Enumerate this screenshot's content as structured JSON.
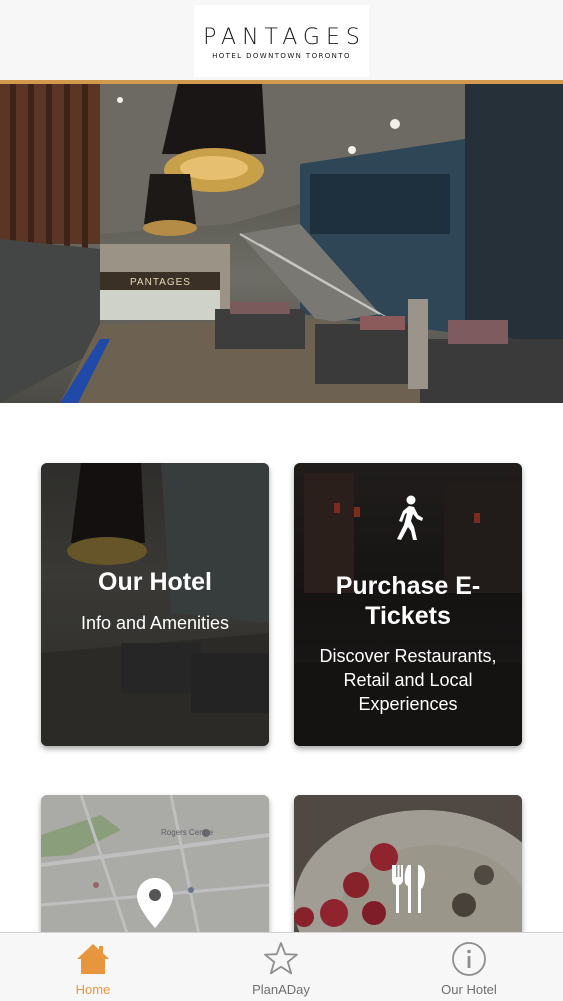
{
  "header": {
    "logo_main": "PANTAGES",
    "logo_sub": "HOTEL DOWNTOWN TORONTO",
    "accent_color": "#d3994f"
  },
  "hero": {
    "sign_text": "PANTAGES"
  },
  "tiles": [
    {
      "title": "Our Hotel",
      "subtitle": "Info and Amenities",
      "icon": "none"
    },
    {
      "title_line1": "Purchase E-",
      "title_line2": "Tickets",
      "subtitle_line1": "Discover Restaurants,",
      "subtitle_line2": "Retail and Local",
      "subtitle_line3": "Experiences",
      "icon": "walking-person-icon"
    },
    {
      "map_label_1": "Rogers Centre",
      "icon": "map-pin-icon"
    },
    {
      "icon": "fork-knife-icon"
    }
  ],
  "tabbar": {
    "active_color": "#e8963d",
    "inactive_color": "#8e8e8e",
    "tabs": [
      {
        "label": "Home",
        "icon": "home-icon",
        "active": true
      },
      {
        "label": "PlanADay",
        "icon": "star-icon",
        "active": false
      },
      {
        "label": "Our Hotel",
        "icon": "info-icon",
        "active": false
      }
    ]
  }
}
